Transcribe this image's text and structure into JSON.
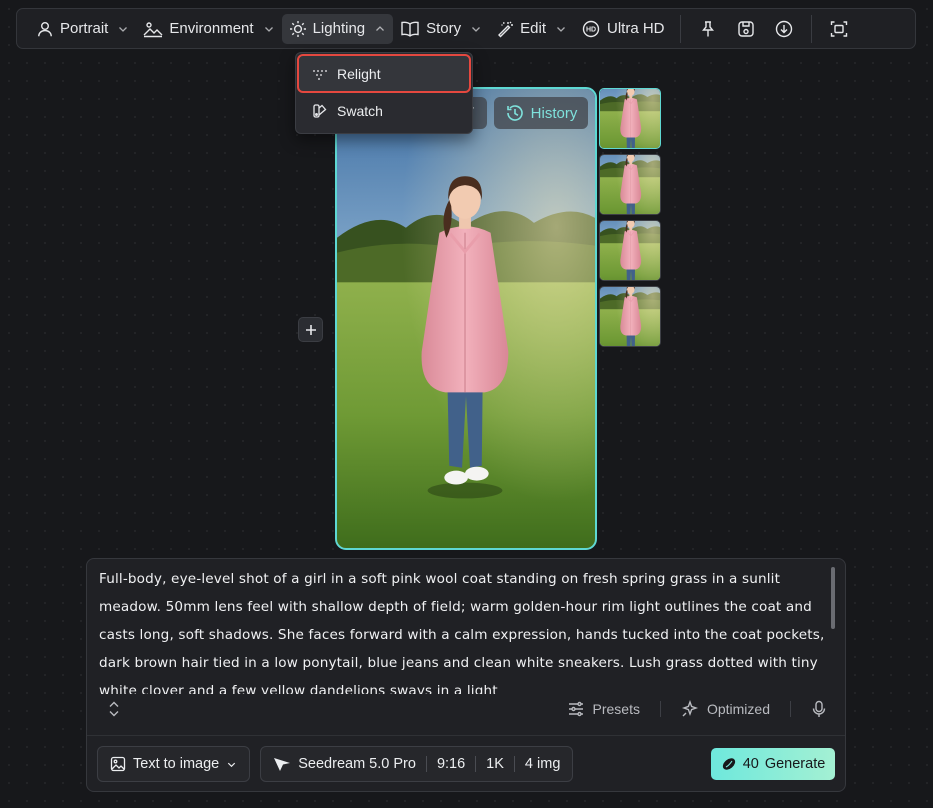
{
  "toolbar": {
    "portrait": "Portrait",
    "environment": "Environment",
    "lighting": "Lighting",
    "story": "Story",
    "edit": "Edit",
    "ultra_hd": "Ultra HD",
    "right_icons": [
      "pin-icon",
      "save-icon",
      "download-icon",
      "fullscreen-icon"
    ]
  },
  "lighting_menu": {
    "items": [
      {
        "label": "Relight",
        "icon": "relight-icon",
        "selected": true
      },
      {
        "label": "Swatch",
        "icon": "swatch-icon",
        "selected": false
      }
    ]
  },
  "canvas": {
    "history_label": "History",
    "thumbnail_count": 4,
    "accent_color": "#5ed8d3"
  },
  "prompt": {
    "text": "Full-body, eye-level shot of a girl in a soft pink wool coat standing on fresh spring grass in a sunlit meadow. 50mm lens feel with shallow depth of field; warm golden-hour rim light outlines the coat and casts long, soft shadows. She faces forward with a calm expression, hands tucked into the coat pockets, dark brown hair tied in a low ponytail, blue jeans and clean white sneakers. Lush grass dotted with tiny white clover and a few yellow dandelions sways in a light",
    "presets_label": "Presets",
    "optimized_label": "Optimized"
  },
  "bottom_bar": {
    "mode": "Text to image",
    "model": "Seedream 5.0 Pro",
    "ratio": "9:16",
    "resolution": "1K",
    "count": "4 img",
    "credits": "40",
    "generate_label": "Generate"
  }
}
